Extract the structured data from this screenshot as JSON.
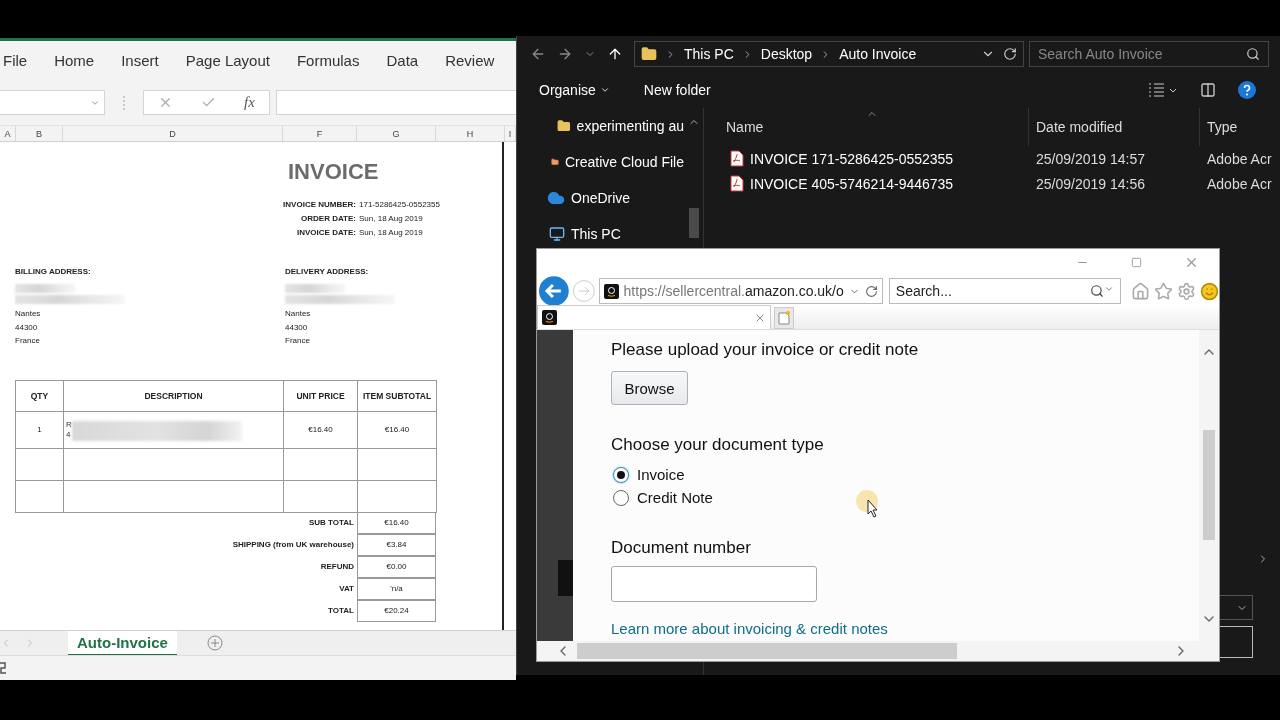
{
  "excel": {
    "fx_label": "fx",
    "ribbon_tabs": [
      "File",
      "Home",
      "Insert",
      "Page Layout",
      "Formulas",
      "Data",
      "Review"
    ],
    "columns": [
      "A",
      "B",
      "D",
      "F",
      "G",
      "H",
      "I"
    ],
    "invoice": {
      "title": "INVOICE",
      "meta": [
        {
          "label": "INVOICE NUMBER:",
          "value": "171-5286425-0552355"
        },
        {
          "label": "ORDER DATE:",
          "value": "Sun, 18 Aug 2019"
        },
        {
          "label": "INVOICE DATE:",
          "value": "Sun, 18 Aug 2019"
        }
      ],
      "addresses": [
        {
          "label": "BILLING ADDRESS:",
          "lines": [
            "Nantes",
            "44300",
            "France"
          ]
        },
        {
          "label": "DELIVERY ADDRESS:",
          "lines": [
            "Nantes",
            "44300",
            "France"
          ]
        }
      ],
      "table_columns": [
        "QTY",
        "DESCRIPTION",
        "UNIT PRICE",
        "ITEM SUBTOTAL"
      ],
      "rows": [
        {
          "kind": "item",
          "qty": "1",
          "description": [
            "R",
            "4"
          ],
          "unit_price": "€16.40",
          "subtotal": "€16.40"
        },
        {
          "kind": "blank"
        },
        {
          "kind": "blank"
        }
      ],
      "totals": [
        {
          "label": "SUB TOTAL",
          "value": "€16.40"
        },
        {
          "label": "SHIPPING (from UK warehouse)",
          "value": "€3.84"
        },
        {
          "label": "REFUND",
          "value": "€0.00"
        },
        {
          "label": "VAT",
          "value": "'n/a"
        },
        {
          "label": "TOTAL",
          "value": "€20.24"
        }
      ]
    },
    "sheet_tabs": [
      {
        "label": "Auto-Invoice",
        "selected": true
      }
    ]
  },
  "explorer": {
    "breadcrumb": [
      "This PC",
      "Desktop",
      "Auto Invoice"
    ],
    "search": {
      "placeholder": "Search Auto Invoice"
    },
    "toolbar": [
      "Organise",
      "New folder"
    ],
    "nav": [
      {
        "label": "experimenting au",
        "kind": "folder"
      },
      {
        "label": "Creative Cloud File",
        "kind": "cloud-folder"
      },
      {
        "label": "OneDrive",
        "kind": "onedrive"
      },
      {
        "label": "This PC",
        "kind": "pc"
      }
    ],
    "columns": [
      "Name",
      "Date modified",
      "Type"
    ],
    "files": [
      {
        "name": "INVOICE 171-5286425-0552355",
        "date": "25/09/2019 14:57",
        "type": "Adobe Acr"
      },
      {
        "name": "INVOICE 405-5746214-9446735",
        "date": "25/09/2019 14:56",
        "type": "Adobe Acr"
      }
    ]
  },
  "browser": {
    "url": {
      "prefix": "https://sellercentral.",
      "domain": "amazon.co.uk/o"
    },
    "search": {
      "placeholder": "Search..."
    },
    "form": {
      "upload_label": "Please upload your invoice or credit note",
      "browse": "Browse",
      "type_label": "Choose your document type",
      "options": [
        {
          "label": "Invoice",
          "selected": true
        },
        {
          "label": "Credit Note",
          "selected": false
        }
      ],
      "number_label": "Document number",
      "link": "Learn more about invoicing & credit notes"
    }
  }
}
